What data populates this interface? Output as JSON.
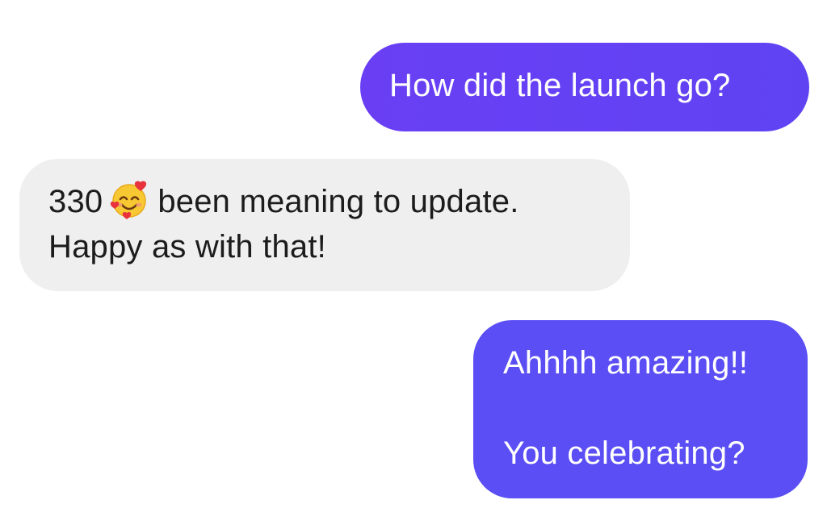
{
  "conversation": {
    "colors": {
      "sent_bubble": "#5f43f3",
      "received_bubble": "#efefef",
      "sent_text": "#ffffff",
      "received_text": "#1c1c1c"
    },
    "messages": [
      {
        "direction": "sent",
        "lines": [
          "How did the launch go?"
        ]
      },
      {
        "direction": "received",
        "line1_before_emoji": "330",
        "emoji": "smiling-face-with-hearts",
        "line1_after_emoji": "been meaning to update.",
        "line2": "Happy as with that!"
      },
      {
        "direction": "sent",
        "lines": [
          "Ahhhh amazing!!",
          "You celebrating?"
        ]
      }
    ]
  }
}
